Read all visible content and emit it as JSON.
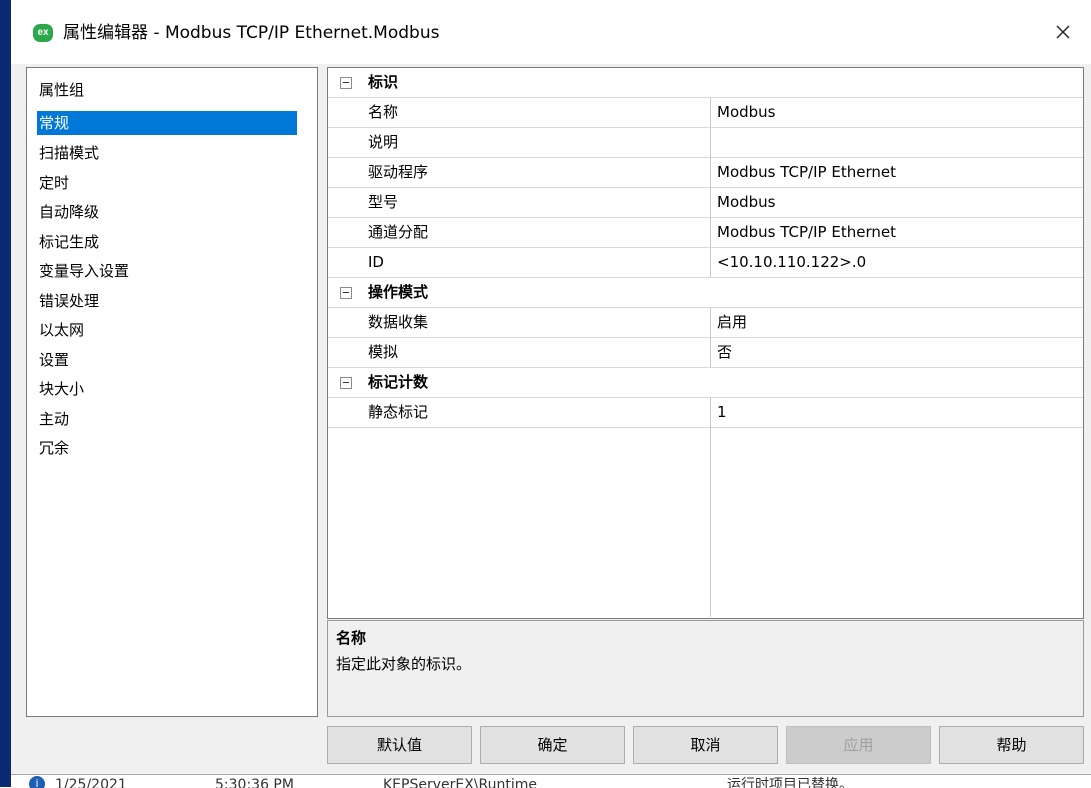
{
  "window": {
    "title": "属性编辑器 - Modbus TCP/IP Ethernet.Modbus",
    "icon_text": "ex",
    "icon": "kepserver-ex-icon",
    "close_icon": "close-icon"
  },
  "nav": {
    "header": "属性组",
    "items": [
      "常规",
      "扫描模式",
      "定时",
      "自动降级",
      "标记生成",
      "变量导入设置",
      "错误处理",
      "以太网",
      "设置",
      "块大小",
      "主动",
      "冗余"
    ],
    "selected": "常规"
  },
  "grid": {
    "groups": [
      {
        "title": "标识",
        "rows": [
          {
            "name": "名称",
            "value": "Modbus"
          },
          {
            "name": "说明",
            "value": ""
          },
          {
            "name": "驱动程序",
            "value": "Modbus TCP/IP Ethernet"
          },
          {
            "name": "型号",
            "value": "Modbus"
          },
          {
            "name": "通道分配",
            "value": "Modbus TCP/IP Ethernet"
          },
          {
            "name": "ID",
            "value": "<10.10.110.122>.0"
          }
        ]
      },
      {
        "title": "操作模式",
        "rows": [
          {
            "name": "数据收集",
            "value": "启用"
          },
          {
            "name": "模拟",
            "value": "否"
          }
        ]
      },
      {
        "title": "标记计数",
        "rows": [
          {
            "name": "静态标记",
            "value": "1"
          }
        ]
      }
    ]
  },
  "description": {
    "title": "名称",
    "text": "指定此对象的标识。"
  },
  "buttons": {
    "defaults": "默认值",
    "ok": "确定",
    "cancel": "取消",
    "apply": "应用",
    "help": "帮助"
  },
  "statusbar": {
    "date": "1/25/2021",
    "time": "5:30:36 PM",
    "source": "KEPServerEX\\Runtime",
    "message": "运行时项目已替换。"
  },
  "colors": {
    "selection": "#0078d7",
    "dialog_bg": "#f0f0f0",
    "left_edge": "#0b2a73"
  }
}
